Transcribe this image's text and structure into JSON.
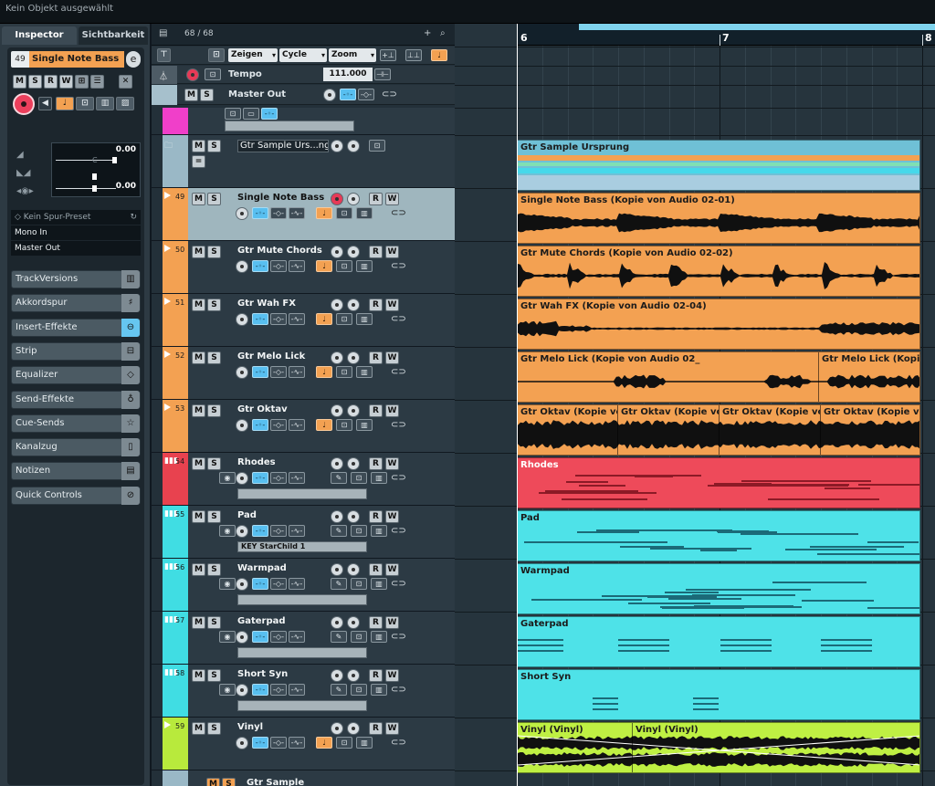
{
  "status_bar": {
    "message": "Kein Objekt ausgewählt"
  },
  "inspector": {
    "tabs": [
      "Inspector",
      "Sichtbarkeit"
    ],
    "track_number": "49",
    "track_name": "Single Note Bass",
    "buttons": [
      "M",
      "S",
      "R",
      "W"
    ],
    "volume": "0.00",
    "pan_label": "C",
    "pan": "0.00",
    "preset": "Kein Spur-Preset",
    "input": "Mono In",
    "output": "Master Out",
    "sections": [
      {
        "label": "TrackVersions",
        "icon": "track-versions-icon",
        "active": false
      },
      {
        "label": "Akkordspur",
        "icon": "chord-icon",
        "active": false
      },
      {
        "label": "Insert-Effekte",
        "icon": "insert-icon",
        "active": true
      },
      {
        "label": "Strip",
        "icon": "strip-icon",
        "active": false
      },
      {
        "label": "Equalizer",
        "icon": "eq-icon",
        "active": false
      },
      {
        "label": "Send-Effekte",
        "icon": "send-icon",
        "active": false
      },
      {
        "label": "Cue-Sends",
        "icon": "star-icon",
        "active": false
      },
      {
        "label": "Kanalzug",
        "icon": "channel-strip-icon",
        "active": false
      },
      {
        "label": "Notizen",
        "icon": "notepad-icon",
        "active": false
      },
      {
        "label": "Quick Controls",
        "icon": "quick-controls-icon",
        "active": false
      }
    ]
  },
  "tracklist": {
    "count": "68 / 68",
    "global": {
      "show": "Zeigen",
      "cycle": "Cycle",
      "zoom": "Zoom"
    },
    "tempo": {
      "label": "Tempo",
      "value": "111.000"
    },
    "master": {
      "label": "Master Out"
    },
    "tracks": [
      {
        "num": "",
        "name": "",
        "type": "midi-partial",
        "color": "#f03fc9"
      },
      {
        "num": "",
        "name": "Gtr Sample Urs...ng",
        "type": "folder",
        "color": "#9ab8c6"
      },
      {
        "num": "49",
        "name": "Single Note Bass",
        "type": "audio",
        "color": "#f3a152",
        "selected": true
      },
      {
        "num": "50",
        "name": "Gtr Mute Chords",
        "type": "audio",
        "color": "#f3a152"
      },
      {
        "num": "51",
        "name": "Gtr Wah FX",
        "type": "audio",
        "color": "#f3a152"
      },
      {
        "num": "52",
        "name": "Gtr Melo Lick",
        "type": "audio",
        "color": "#f3a152"
      },
      {
        "num": "53",
        "name": "Gtr Oktav",
        "type": "audio",
        "color": "#f3a152"
      },
      {
        "num": "54",
        "name": "Rhodes",
        "type": "instrument",
        "color": "#e8424f"
      },
      {
        "num": "55",
        "name": "Pad",
        "type": "instrument",
        "color": "#40dde3",
        "preset": "KEY StarChild 1"
      },
      {
        "num": "56",
        "name": "Warmpad",
        "type": "instrument",
        "color": "#40dde3"
      },
      {
        "num": "57",
        "name": "Gaterpad",
        "type": "instrument",
        "color": "#40dde3"
      },
      {
        "num": "58",
        "name": "Short Syn",
        "type": "instrument",
        "color": "#40dde3"
      },
      {
        "num": "59",
        "name": "Vinyl",
        "type": "audio",
        "color": "#b8ea3c"
      },
      {
        "num": "",
        "name": "Gtr Sample",
        "type": "folder-partial",
        "color": "#9ab8c6"
      }
    ]
  },
  "ruler": {
    "bars": [
      "6",
      "7",
      "8"
    ]
  },
  "parts": [
    {
      "track": "Gtr Sample Ursprung",
      "labels": [
        "Gtr Sample Ursprung"
      ]
    },
    {
      "track": "Single Note Bass",
      "labels": [
        "Single Note Bass (Kopie von Audio 02-01)"
      ]
    },
    {
      "track": "Gtr Mute Chords",
      "labels": [
        "Gtr Mute Chords (Kopie von Audio 02-02)"
      ]
    },
    {
      "track": "Gtr Wah FX",
      "labels": [
        "Gtr Wah FX (Kopie von Audio 02-04)"
      ]
    },
    {
      "track": "Gtr Melo Lick",
      "labels": [
        "Gtr Melo Lick (Kopie von Audio 02_",
        "Gtr Melo Lick (Kopie"
      ]
    },
    {
      "track": "Gtr Oktav",
      "labels": [
        "Gtr Oktav (Kopie von",
        "Gtr Oktav (Kopie von",
        "Gtr Oktav (Kopie von",
        "Gtr Oktav (Kopie von A"
      ]
    },
    {
      "track": "Rhodes",
      "labels": [
        "Rhodes"
      ]
    },
    {
      "track": "Pad",
      "labels": [
        "Pad"
      ]
    },
    {
      "track": "Warmpad",
      "labels": [
        "Warmpad"
      ]
    },
    {
      "track": "Gaterpad",
      "labels": [
        "Gaterpad"
      ]
    },
    {
      "track": "Short Syn",
      "labels": [
        "Short Syn"
      ]
    },
    {
      "track": "Vinyl",
      "labels": [
        "Vinyl (Vinyl)",
        "Vinyl (Vinyl)"
      ]
    }
  ]
}
